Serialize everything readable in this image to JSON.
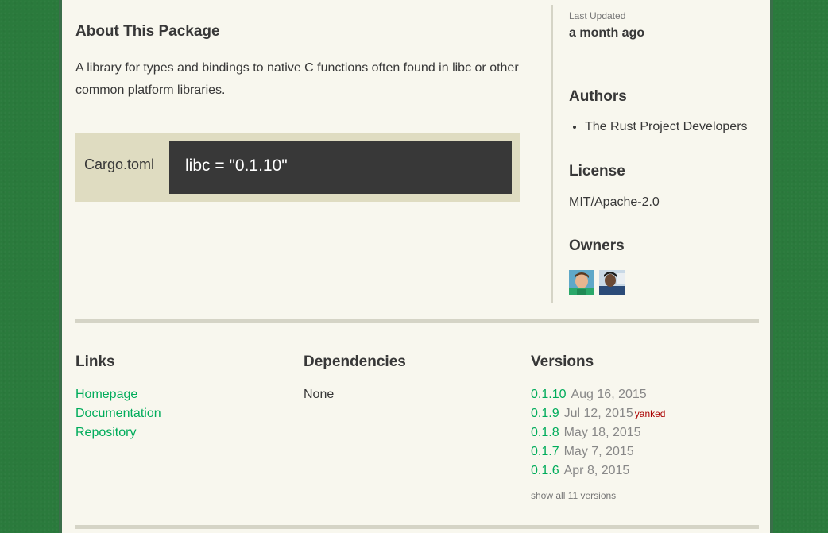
{
  "about": {
    "title": "About This Package",
    "description": "A library for types and bindings to native C functions often found in libc or other common platform libraries."
  },
  "install": {
    "label": "Cargo.toml",
    "code": "libc = \"0.1.10\""
  },
  "sidebar": {
    "last_updated_label": "Last Updated",
    "last_updated_value": "a month ago",
    "authors_title": "Authors",
    "authors": [
      "The Rust Project Developers"
    ],
    "license_title": "License",
    "license_value": "MIT/Apache-2.0",
    "owners_title": "Owners",
    "owners": [
      {
        "icon": "owner-avatar-1"
      },
      {
        "icon": "owner-avatar-2"
      }
    ]
  },
  "links": {
    "title": "Links",
    "items": [
      "Homepage",
      "Documentation",
      "Repository"
    ]
  },
  "dependencies": {
    "title": "Dependencies",
    "none_label": "None"
  },
  "versions": {
    "title": "Versions",
    "items": [
      {
        "num": "0.1.10",
        "date": "Aug 16, 2015",
        "yanked": ""
      },
      {
        "num": "0.1.9",
        "date": "Jul 12, 2015",
        "yanked": "yanked"
      },
      {
        "num": "0.1.8",
        "date": "May 18, 2015",
        "yanked": ""
      },
      {
        "num": "0.1.7",
        "date": "May 7, 2015",
        "yanked": ""
      },
      {
        "num": "0.1.6",
        "date": "Apr 8, 2015",
        "yanked": ""
      }
    ],
    "show_all": "show all 11 versions"
  },
  "colors": {
    "background": "#2a7a3c",
    "page": "#f8f7ee",
    "link": "#00ac5b",
    "code_bg": "#383838",
    "install_bg": "#dfdcc1",
    "yanked": "#aa0000"
  }
}
